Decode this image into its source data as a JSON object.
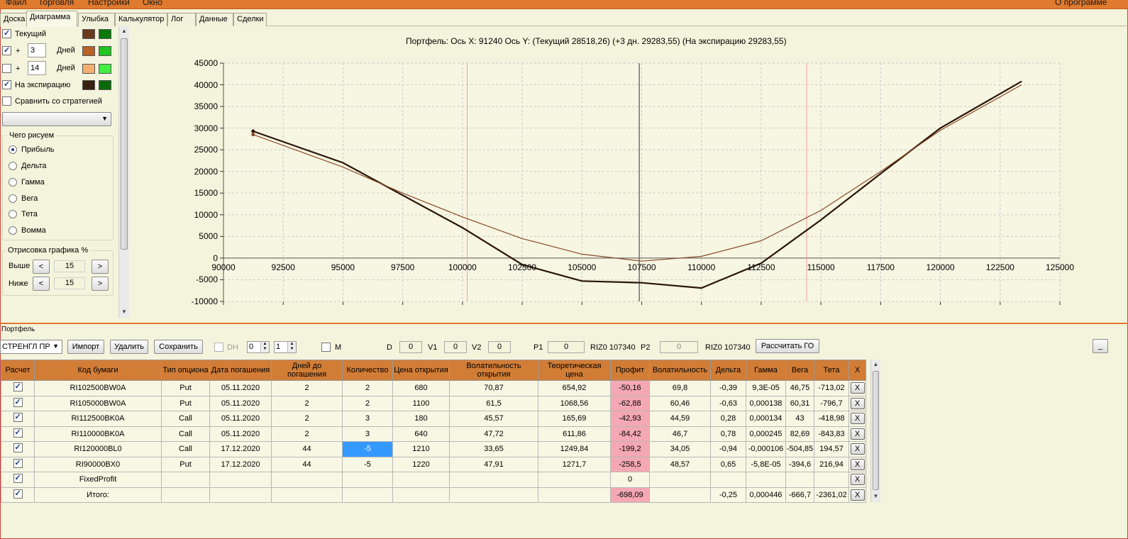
{
  "menu": {
    "file": "Файл",
    "trade": "Торговля",
    "settings": "Настройки",
    "window": "Окно",
    "about": "О программе"
  },
  "tabs": [
    "Доска",
    "Диаграмма",
    "Улыбка",
    "Калькулятор",
    "Лог",
    "Данные",
    "Сделки"
  ],
  "left": {
    "current": "Текущий",
    "plus": "+",
    "days_1": "3",
    "days_2": "14",
    "days_label": "Дней",
    "expiry": "На экспирацию",
    "compare": "Сравнить со стратегией",
    "draw_group": "Чего рисуем",
    "radios": [
      "Прибыль",
      "Дельта",
      "Гамма",
      "Вега",
      "Тета",
      "Вомма"
    ],
    "render_group": "Отрисовка графика %",
    "above": "Выше",
    "below": "Ниже",
    "above_val": "15",
    "below_val": "15",
    "prev": "<",
    "next": ">",
    "colors": {
      "current_a": "#6a3a1e",
      "current_b": "#0a7a0a",
      "d3_a": "#b8622a",
      "d3_b": "#22c422",
      "d14_a": "#f4b070",
      "d14_b": "#44ee44",
      "exp_a": "#3a2010",
      "exp_b": "#0a6a0a"
    }
  },
  "chart_title": "Портфель: Ось X: 91240 Ось Y:  (Текущий 28518,26)  (+3 дн. 29283,55)  (На экспирацию 29283,55)",
  "chart_data": {
    "type": "line",
    "title": "Портфель: Ось X: 91240 Ось Y:  (Текущий 28518,26)  (+3 дн. 29283,55)  (На экспирацию 29283,55)",
    "xlim": [
      90000,
      125000
    ],
    "ylim": [
      -10000,
      45000
    ],
    "x_ticks": [
      "90000",
      "92500",
      "95000",
      "97500",
      "100000",
      "102500",
      "105000",
      "107500",
      "110000",
      "112500",
      "115000",
      "117500",
      "120000",
      "122500",
      "125000"
    ],
    "y_ticks": [
      "45000",
      "40000",
      "35000",
      "30000",
      "25000",
      "20000",
      "15000",
      "10000",
      "5000",
      "0",
      "-5000",
      "-10000"
    ],
    "vertical_lines": [
      {
        "x": 100200,
        "color": "#f0a0a0"
      },
      {
        "x": 107400,
        "color": "#707070"
      },
      {
        "x": 114400,
        "color": "#f0a0a0"
      }
    ],
    "series": [
      {
        "color": "#2a1508",
        "x": [
          91240,
          95000,
          100000,
          102500,
          105000,
          107500,
          110000,
          112500,
          115000,
          117500,
          120000,
          123400
        ],
        "y": [
          29283,
          22000,
          7000,
          -1500,
          -5300,
          -5700,
          -6900,
          -1200,
          8800,
          19500,
          30000,
          40800
        ]
      },
      {
        "color": "#8a4a2a",
        "x": [
          91240,
          95000,
          97500,
          100000,
          102500,
          105000,
          107500,
          110000,
          112500,
          115000,
          117500,
          120000,
          123400
        ],
        "y": [
          28518,
          21000,
          15000,
          9500,
          4500,
          900,
          -700,
          400,
          4000,
          11000,
          20000,
          29500,
          40000
        ]
      }
    ]
  },
  "portfolio": {
    "title": "Портфель",
    "strategy": "СТРЕНГЛ ПР",
    "import": "Импорт",
    "delete": "Удалить",
    "save": "Сохранить",
    "dh": "DH",
    "spin1": "0",
    "spin2": "1",
    "m": "M",
    "d_label": "D",
    "d_val": "0",
    "v1_label": "V1",
    "v1_val": "0",
    "v2_label": "V2",
    "v2_val": "0",
    "p1_label": "P1",
    "p1_val": "0",
    "riz1": "RIZ0 107340",
    "p2_label": "P2",
    "p2_val": "0",
    "riz2": "RIZ0 107340",
    "calc_go": "Рассчитать ГО",
    "minimize": "_"
  },
  "table": {
    "headers": [
      "Расчет",
      "Код бумаги",
      "Тип опциона",
      "Дата погашения",
      "Дней до погашения",
      "Количество",
      "Цена открытия",
      "Волатильность открытия",
      "Теоретическая цена",
      "Профит",
      "Волатильность",
      "Дельта",
      "Гамма",
      "Вега",
      "Тета",
      "X"
    ],
    "rows": [
      [
        "RI102500BW0A",
        "Put",
        "05.11.2020",
        "2",
        "2",
        "680",
        "70,87",
        "654,92",
        "-50,16",
        "69,8",
        "-0,39",
        "9,3E-05",
        "46,75",
        "-713,02"
      ],
      [
        "RI105000BW0A",
        "Put",
        "05.11.2020",
        "2",
        "2",
        "1100",
        "61,5",
        "1068,56",
        "-62,88",
        "60,46",
        "-0,63",
        "0,000138",
        "60,31",
        "-796,7"
      ],
      [
        "RI112500BK0A",
        "Call",
        "05.11.2020",
        "2",
        "3",
        "180",
        "45,57",
        "165,69",
        "-42,93",
        "44,59",
        "0,28",
        "0,000134",
        "43",
        "-418,98"
      ],
      [
        "RI110000BK0A",
        "Call",
        "05.11.2020",
        "2",
        "3",
        "640",
        "47,72",
        "611,86",
        "-84,42",
        "46,7",
        "0,78",
        "0,000245",
        "82,69",
        "-843,83"
      ],
      [
        "RI120000BL0",
        "Call",
        "17.12.2020",
        "44",
        "-5",
        "1210",
        "33,65",
        "1249,84",
        "-199,2",
        "34,05",
        "-0,94",
        "-0,000106",
        "-504,85",
        "194,57"
      ],
      [
        "RI90000BX0",
        "Put",
        "17.12.2020",
        "44",
        "-5",
        "1220",
        "47,91",
        "1271,7",
        "-258,5",
        "48,57",
        "0,65",
        "-5,8E-05",
        "-394,6",
        "216,94"
      ],
      [
        "FixedProfit",
        "",
        "",
        "",
        "",
        "",
        "",
        "",
        "0",
        "",
        "",
        "",
        "",
        ""
      ],
      [
        "Итого:",
        "",
        "",
        "",
        "",
        "",
        "",
        "",
        "-698,09",
        "",
        "-0,25",
        "0,000446",
        "-666,7",
        "-2361,02"
      ]
    ],
    "x": "X"
  }
}
